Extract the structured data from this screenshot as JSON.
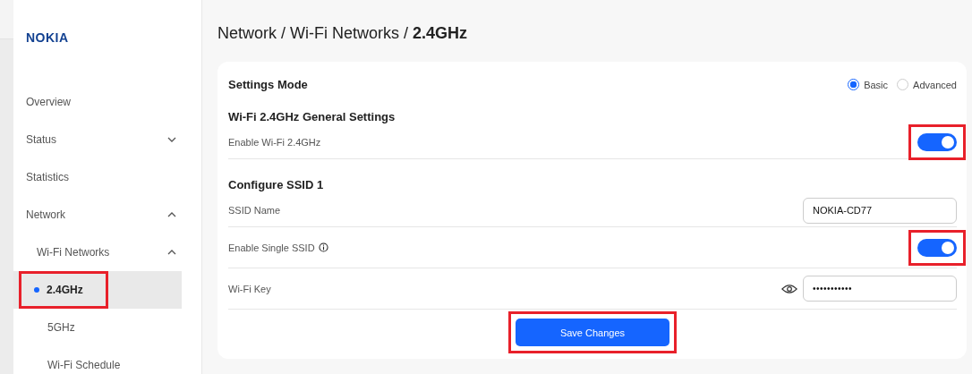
{
  "logo": "NOKIA",
  "sidebar": {
    "items": [
      {
        "label": "Overview",
        "selected": false
      },
      {
        "label": "Status",
        "expanded": false,
        "selected": false
      },
      {
        "label": "Statistics",
        "selected": false
      },
      {
        "label": "Network",
        "expanded": true,
        "selected": false,
        "children": [
          {
            "label": "Wi-Fi Networks",
            "expanded": true,
            "selected": false,
            "children": [
              {
                "label": "2.4GHz",
                "selected": true,
                "highlighted": true
              },
              {
                "label": "5GHz",
                "selected": false,
                "highlighted": false
              },
              {
                "label": "Wi-Fi Schedule",
                "selected": false,
                "highlighted": false
              }
            ]
          }
        ]
      }
    ]
  },
  "breadcrumb": {
    "path": "Network / Wi-Fi Networks / ",
    "current": "2.4GHz"
  },
  "settings_mode": {
    "title": "Settings Mode",
    "options": [
      {
        "label": "Basic",
        "selected": true
      },
      {
        "label": "Advanced",
        "selected": false
      }
    ]
  },
  "sections": [
    {
      "title": "Wi-Fi 2.4GHz General Settings",
      "rows": [
        {
          "kind": "toggle",
          "label": "Enable Wi-Fi 2.4GHz",
          "on": true,
          "highlighted": true
        }
      ]
    },
    {
      "title": "Configure SSID 1",
      "rows": [
        {
          "kind": "text",
          "label": "SSID Name",
          "value": "NOKIA-CD77"
        },
        {
          "kind": "toggle",
          "label": "Enable Single SSID",
          "info": true,
          "on": true,
          "highlighted": true
        },
        {
          "kind": "password",
          "label": "Wi-Fi Key",
          "value": "•••••••••••"
        }
      ]
    }
  ],
  "save_button": {
    "label": "Save Changes",
    "highlighted": true
  }
}
